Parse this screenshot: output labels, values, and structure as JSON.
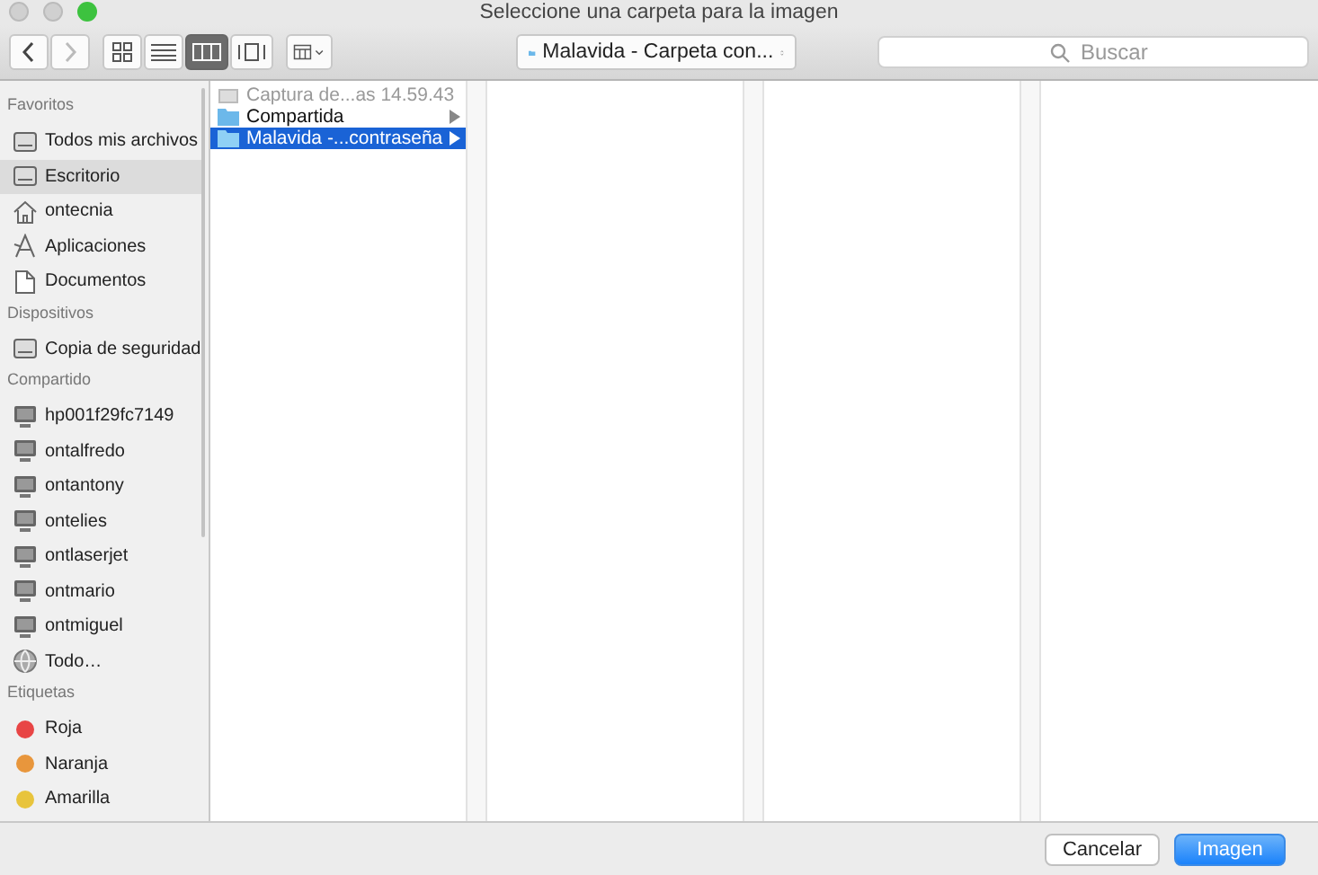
{
  "window": {
    "title": "Seleccione una carpeta para la imagen"
  },
  "toolbar": {
    "view_buttons": [
      {
        "kind": "icons",
        "selected": false
      },
      {
        "kind": "list",
        "selected": false
      },
      {
        "kind": "columns",
        "selected": true
      },
      {
        "kind": "coverflow",
        "selected": false
      }
    ],
    "location": "Malavida - Carpeta con...",
    "search": {
      "placeholder": "Buscar"
    }
  },
  "sidebar": {
    "sections": [
      {
        "title": "Favoritos",
        "items": [
          {
            "label": "Todos mis archivos",
            "kind": "drawer",
            "selected": false
          },
          {
            "label": "Escritorio",
            "kind": "desktop",
            "selected": true
          },
          {
            "label": "ontecnia",
            "kind": "home",
            "selected": false
          },
          {
            "label": "Aplicaciones",
            "kind": "apps",
            "selected": false
          },
          {
            "label": "Documentos",
            "kind": "document",
            "selected": false
          }
        ]
      },
      {
        "title": "Dispositivos",
        "items": [
          {
            "label": "Copia de seguridad",
            "kind": "drive",
            "selected": false
          }
        ]
      },
      {
        "title": "Compartido",
        "items": [
          {
            "label": "hp001f29fc7149",
            "kind": "computer",
            "selected": false
          },
          {
            "label": "ontalfredo",
            "kind": "computer",
            "selected": false
          },
          {
            "label": "ontantony",
            "kind": "computer",
            "selected": false
          },
          {
            "label": "ontelies",
            "kind": "computer",
            "selected": false
          },
          {
            "label": "ontlaserjet",
            "kind": "computer",
            "selected": false
          },
          {
            "label": "ontmario",
            "kind": "computer",
            "selected": false
          },
          {
            "label": "ontmiguel",
            "kind": "computer",
            "selected": false
          },
          {
            "label": "Todo…",
            "kind": "globe",
            "selected": false
          }
        ]
      },
      {
        "title": "Etiquetas",
        "items": [
          {
            "label": "Roja",
            "kind": "tag",
            "color": "#e84545",
            "selected": false
          },
          {
            "label": "Naranja",
            "kind": "tag",
            "color": "#e8963c",
            "selected": false
          },
          {
            "label": "Amarilla",
            "kind": "tag",
            "color": "#e8c43c",
            "selected": false
          }
        ]
      }
    ]
  },
  "columns": [
    {
      "files": [
        {
          "name": "Captura de...as 14.59.43",
          "kind": "image",
          "disabled": true,
          "expandable": false,
          "selected": false
        },
        {
          "name": "Compartida",
          "kind": "folder",
          "disabled": false,
          "expandable": true,
          "selected": false
        },
        {
          "name": "Malavida -...contraseña",
          "kind": "folder",
          "disabled": false,
          "expandable": true,
          "selected": true
        }
      ]
    }
  ],
  "buttons": [
    {
      "label": "Cancelar",
      "kind": "secondary"
    },
    {
      "label": "Imagen",
      "kind": "primary"
    }
  ]
}
